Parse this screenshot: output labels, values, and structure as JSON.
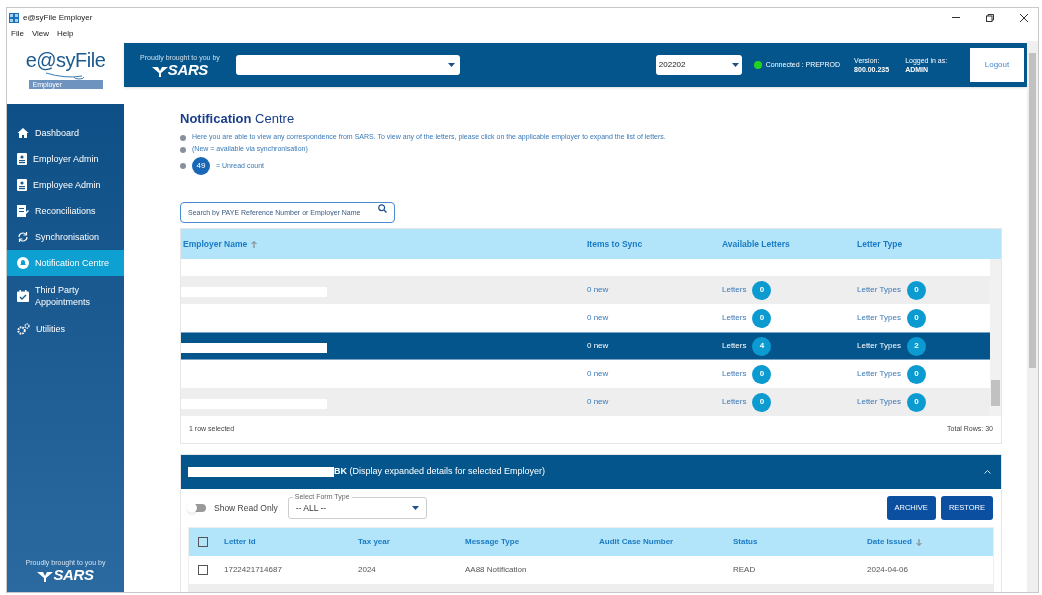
{
  "window": {
    "title": "e@syFile Employer"
  },
  "menu": [
    "File",
    "View",
    "Help"
  ],
  "logo": {
    "name": "e@syFile",
    "badge": "Employer"
  },
  "sidebar": {
    "items": [
      {
        "label": "Dashboard",
        "kind": "home",
        "selected": false
      },
      {
        "label": "Employer Admin",
        "kind": "badge",
        "selected": false
      },
      {
        "label": "Employee Admin",
        "kind": "badge",
        "selected": false
      },
      {
        "label": "Reconciliations",
        "kind": "doc",
        "selected": false
      },
      {
        "label": "Synchronisation",
        "kind": "sync",
        "selected": false
      },
      {
        "label": "Notification Centre",
        "kind": "bell",
        "selected": true
      },
      {
        "label": "Third Party Appointments",
        "kind": "calendar",
        "selected": false
      },
      {
        "label": "Utilities",
        "kind": "gears",
        "selected": false
      }
    ],
    "footer_tagline": "Proudly brought to you by",
    "footer_brand": "SARS"
  },
  "header": {
    "tagline": "Proudly brought to you by",
    "brand": "SARS",
    "period": "202202",
    "connection": "Connected : PREPROD",
    "connected": true,
    "version_label": "Version:",
    "version": "800.00.235",
    "login_label": "Logged in as:",
    "user": "ADMIN",
    "logout": "Logout"
  },
  "page": {
    "title_bold": "Notification",
    "title_rest": "Centre",
    "info": [
      "Here you are able to view any correspondence from SARS. To view any of the letters, please click on the applicable employer to expand the list of letters.",
      "(New = available via synchronisation)"
    ],
    "unread_badge": "49",
    "unread_text": "= Unread count"
  },
  "search": {
    "placeholder": "Search by PAYE Reference Number or Employer Name"
  },
  "table": {
    "columns": [
      "Employer Name",
      "Items to Sync",
      "Available Letters",
      "Letter Type"
    ],
    "rows": [
      {
        "sync": "0 new",
        "letters_label": "Letters",
        "letters": "0",
        "types_label": "Letter Types",
        "types": "0",
        "selected": false
      },
      {
        "sync": "0 new",
        "letters_label": "Letters",
        "letters": "0",
        "types_label": "Letter Types",
        "types": "0",
        "selected": false
      },
      {
        "sync": "0 new",
        "letters_label": "Letters",
        "letters": "4",
        "types_label": "Letter Types",
        "types": "2",
        "selected": true
      },
      {
        "sync": "0 new",
        "letters_label": "Letters",
        "letters": "0",
        "types_label": "Letter Types",
        "types": "0",
        "selected": false
      },
      {
        "sync": "0 new",
        "letters_label": "Letters",
        "letters": "0",
        "types_label": "Letter Types",
        "types": "0",
        "selected": false
      }
    ],
    "selection": "1 row selected",
    "total": "Total Rows: 30"
  },
  "details": {
    "title_suffix": "BK",
    "title_note": "(Display expanded details for selected Employer)",
    "expanded": true,
    "show_read_only": {
      "label": "Show Read Only",
      "on": false
    },
    "form_type": {
      "label": "Select Form Type",
      "value": "-- ALL --"
    },
    "buttons": [
      "ARCHIVE",
      "RESTORE"
    ],
    "all_checked": false,
    "columns": [
      "Letter Id",
      "Tax year",
      "Message Type",
      "Audit Case Number",
      "Status",
      "Date Issued"
    ],
    "rows": [
      {
        "checked": false,
        "cells": [
          "1722421714687",
          "2024",
          "AA88 Notification",
          "",
          "READ",
          "2024-04-06"
        ]
      }
    ]
  }
}
